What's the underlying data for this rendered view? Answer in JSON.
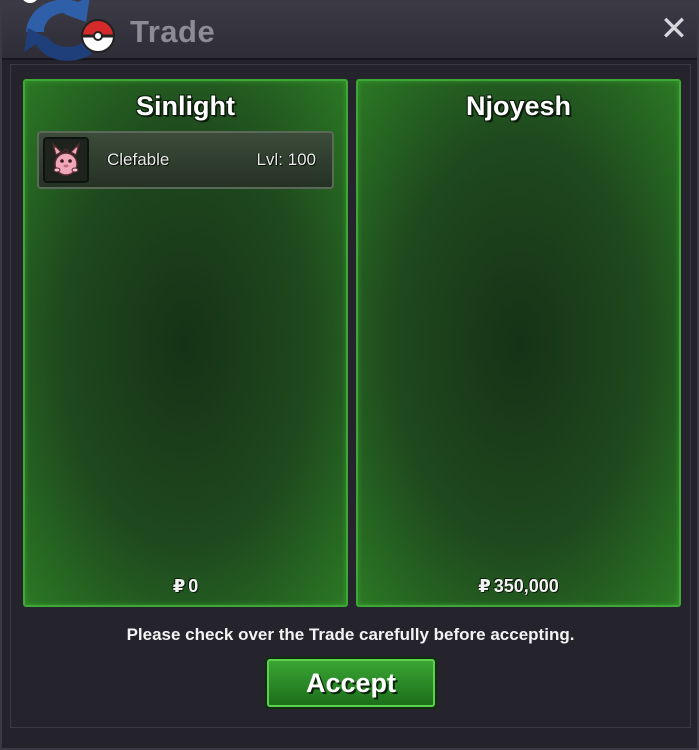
{
  "window": {
    "title": "Trade",
    "close_icon": "close-icon"
  },
  "trade": {
    "left": {
      "player_name": "Sinlight",
      "pokemon": [
        {
          "name": "Clefable",
          "level": "Lvl: 100",
          "icon": "clefable-sprite-icon"
        }
      ],
      "currency_symbol": "₽",
      "money": "0"
    },
    "right": {
      "player_name": "Njoyesh",
      "pokemon": [],
      "currency_symbol": "₽",
      "money": "350,000"
    }
  },
  "notice": "Please check over the Trade carefully before accepting.",
  "accept_label": "Accept",
  "colors": {
    "panel_green": "#2b7d24",
    "accept_green": "#3aa534",
    "window_bg": "#24232c"
  }
}
